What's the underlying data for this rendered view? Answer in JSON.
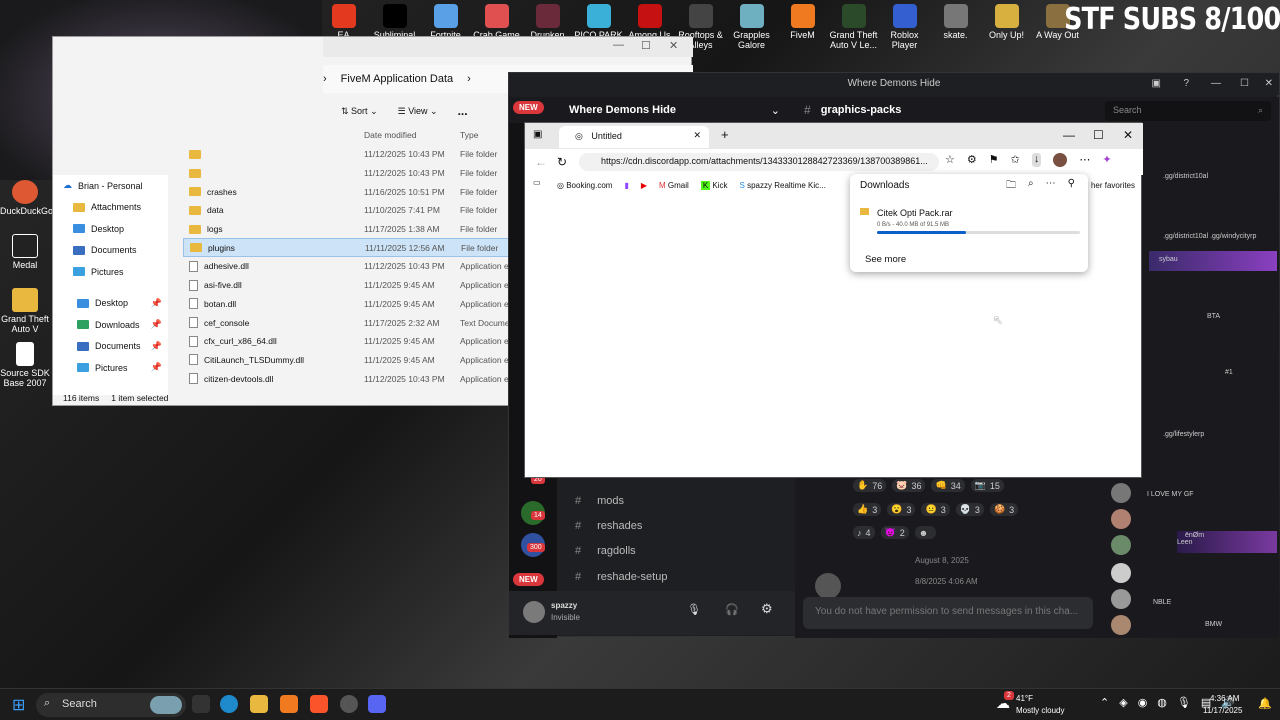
{
  "desktop": {
    "top_icons": [
      {
        "label": "EA",
        "color": "#e33a1f"
      },
      {
        "label": "Subliminal",
        "color": "#000000"
      },
      {
        "label": "Fortnite",
        "color": "#5aa0e6"
      },
      {
        "label": "Crab Game",
        "color": "#e05050"
      },
      {
        "label": "Drunken",
        "color": "#6a2a3a"
      },
      {
        "label": "PICO PARK",
        "color": "#3ab0d8"
      },
      {
        "label": "Among Us",
        "color": "#c51111"
      },
      {
        "label": "Rooftops & Alleys",
        "color": "#444444"
      },
      {
        "label": "Grapples Galore",
        "color": "#6fb0c0"
      },
      {
        "label": "FiveM",
        "color": "#f07a20"
      },
      {
        "label": "Grand Theft Auto V Le...",
        "color": "#2a4a2a"
      },
      {
        "label": "Roblox Player",
        "color": "#335fd0"
      },
      {
        "label": "skate.",
        "color": "#777777"
      },
      {
        "label": "Only Up!",
        "color": "#d8b040"
      },
      {
        "label": "A Way Out",
        "color": "#8a7040"
      }
    ],
    "overlay_text": "STF SUBS 8/100",
    "left_icons": [
      {
        "label": "DuckDuckGo",
        "color": "#de5833"
      },
      {
        "label": "Medal",
        "color": "#222222"
      },
      {
        "label": "Grand Theft Auto V",
        "color": "#e8b93e"
      },
      {
        "label": "Source SDK Base 2007",
        "color": "#ffffff"
      }
    ]
  },
  "explorer": {
    "breadcrumb": [
      "FiveM Application Data"
    ],
    "toolbar": {
      "sort": "Sort",
      "view": "View",
      "more": "..."
    },
    "nav": [
      "Brian - Personal",
      "Attachments",
      "Desktop",
      "Documents",
      "Pictures",
      "Desktop",
      "Downloads",
      "Documents",
      "Pictures"
    ],
    "columns": {
      "date": "Date modified",
      "type": "Type"
    },
    "files": [
      {
        "name": "",
        "date": "11/12/2025 10:43 PM",
        "type": "File folder",
        "kind": "folder"
      },
      {
        "name": "",
        "date": "11/12/2025 10:43 PM",
        "type": "File folder",
        "kind": "folder"
      },
      {
        "name": "crashes",
        "date": "11/16/2025 10:51 PM",
        "type": "File folder",
        "kind": "folder"
      },
      {
        "name": "data",
        "date": "11/10/2025 7:41 PM",
        "type": "File folder",
        "kind": "folder"
      },
      {
        "name": "logs",
        "date": "11/17/2025 1:38 AM",
        "type": "File folder",
        "kind": "folder"
      },
      {
        "name": "plugins",
        "date": "11/11/2025 12:56 AM",
        "type": "File folder",
        "kind": "folder",
        "selected": true
      },
      {
        "name": "adhesive.dll",
        "date": "11/12/2025 10:43 PM",
        "type": "Application e",
        "kind": "dll"
      },
      {
        "name": "asi-five.dll",
        "date": "11/1/2025 9:45 AM",
        "type": "Application e",
        "kind": "dll"
      },
      {
        "name": "botan.dll",
        "date": "11/1/2025 9:45 AM",
        "type": "Application e",
        "kind": "dll"
      },
      {
        "name": "cef_console",
        "date": "11/17/2025 2:32 AM",
        "type": "Text Documen",
        "kind": "dll"
      },
      {
        "name": "cfx_curl_x86_64.dll",
        "date": "11/1/2025 9:45 AM",
        "type": "Application e",
        "kind": "dll"
      },
      {
        "name": "CitiLaunch_TLSDummy.dll",
        "date": "11/1/2025 9:45 AM",
        "type": "Application e",
        "kind": "dll"
      },
      {
        "name": "citizen-devtools.dll",
        "date": "11/12/2025 10:43 PM",
        "type": "Application e",
        "kind": "dll"
      }
    ],
    "status": {
      "count": "116 items",
      "selected": "1 item selected"
    }
  },
  "discord": {
    "window_title": "Where Demons Hide",
    "server_name": "Where Demons Hide",
    "channel": "graphics-packs",
    "search_placeholder": "Search",
    "new_badge": "NEW",
    "channels": [
      "mods",
      "reshades",
      "ragdolls",
      "reshade-setup"
    ],
    "guild_badges": [
      "20",
      "14",
      "300"
    ],
    "user": {
      "name": "spazzy",
      "status": "Invisible"
    },
    "reactions_row1": [
      {
        "e": "✋",
        "n": "76"
      },
      {
        "e": "🐷",
        "n": "36"
      },
      {
        "e": "👊",
        "n": "34"
      },
      {
        "e": "📷",
        "n": "15"
      }
    ],
    "reactions_row2": [
      {
        "e": "👍",
        "n": "3"
      },
      {
        "e": "😮",
        "n": "3"
      },
      {
        "e": "😐",
        "n": "3"
      },
      {
        "e": "💀",
        "n": "3"
      },
      {
        "e": "🍪",
        "n": "3"
      }
    ],
    "reactions_row3": [
      {
        "e": "♪",
        "n": "4"
      },
      {
        "e": "😈",
        "n": "2"
      },
      {
        "e": "☻",
        "n": ""
      }
    ],
    "date_divider": "August 8, 2025",
    "msg_time": "8/8/2025 4:06 AM",
    "input_placeholder": "You do not have permission to send messages in this cha...",
    "members": {
      "invite1": ".gg/district10al",
      "invite2": ".gg/district10al .gg/windycityrp",
      "tag_sybau": "sybau",
      "tag_bta": "BTA",
      "tag_1": "#1",
      "invite3": ".gg/lifestylerp",
      "gf": "I LOVE MY GF",
      "enom": "ēnØm",
      "leen": "Leen",
      "nble": "NBLE",
      "bmw": "BMW"
    }
  },
  "edge": {
    "tab_title": "Untitled",
    "url": "https://cdn.discordapp.com/attachments/1343330128842723369/138700389861...",
    "favorites": [
      "Booking.com",
      "Gmail",
      "Kick",
      "spazzy Realtime Kic..."
    ],
    "other_favorites": "her favorites",
    "downloads": {
      "title": "Downloads",
      "file": "Citek Opti Pack.rar",
      "progress_text": "0 B/s - 40.0 MB of 91.5 MB",
      "progress": 0.44,
      "see_more": "See more"
    }
  },
  "taskbar": {
    "search": "Search",
    "weather_temp": "41°F",
    "weather_desc": "Mostly cloudy",
    "weather_badge": "2",
    "time": "4:36 AM",
    "date": "11/17/2025"
  }
}
